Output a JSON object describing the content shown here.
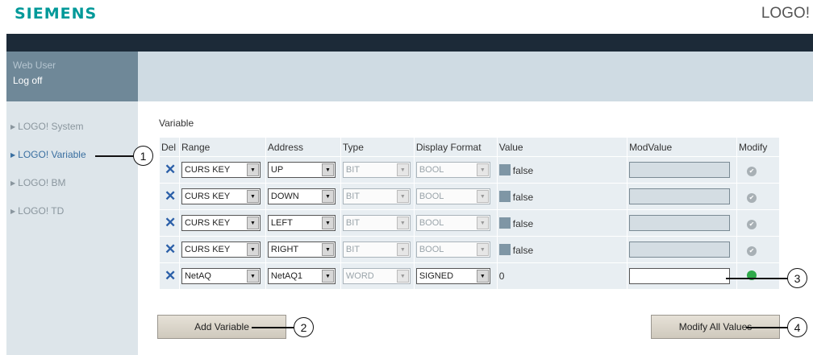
{
  "header": {
    "brand": "SIEMENS",
    "product": "LOGO!"
  },
  "session": {
    "web_user": "Web User",
    "log_off": "Log off"
  },
  "sidebar": {
    "items": [
      {
        "label": "LOGO! System"
      },
      {
        "label": "LOGO! Variable"
      },
      {
        "label": "LOGO! BM"
      },
      {
        "label": "LOGO! TD"
      }
    ]
  },
  "main": {
    "section_title": "Variable",
    "columns": [
      "Del",
      "Range",
      "Address",
      "Type",
      "Display Format",
      "Value",
      "ModValue",
      "Modify"
    ],
    "rows": [
      {
        "del": "✕",
        "range": "CURS KEY",
        "address": "UP",
        "type": "BIT",
        "format": "BOOL",
        "value": "false",
        "modvalue": ""
      },
      {
        "del": "✕",
        "range": "CURS KEY",
        "address": "DOWN",
        "type": "BIT",
        "format": "BOOL",
        "value": "false",
        "modvalue": ""
      },
      {
        "del": "✕",
        "range": "CURS KEY",
        "address": "LEFT",
        "type": "BIT",
        "format": "BOOL",
        "value": "false",
        "modvalue": ""
      },
      {
        "del": "✕",
        "range": "CURS KEY",
        "address": "RIGHT",
        "type": "BIT",
        "format": "BOOL",
        "value": "false",
        "modvalue": ""
      },
      {
        "del": "✕",
        "range": "NetAQ",
        "address": "NetAQ1",
        "type": "WORD",
        "format": "SIGNED",
        "value": "0",
        "modvalue": ""
      }
    ],
    "add_variable": "Add Variable",
    "modify_all": "Modify All Values"
  },
  "callouts": [
    "1",
    "2",
    "3",
    "4"
  ],
  "colors": {
    "brand": "#009999",
    "topbar": "#1c2a38",
    "active_link": "#3a6fa0",
    "modify_ok": "#2fa94a"
  }
}
